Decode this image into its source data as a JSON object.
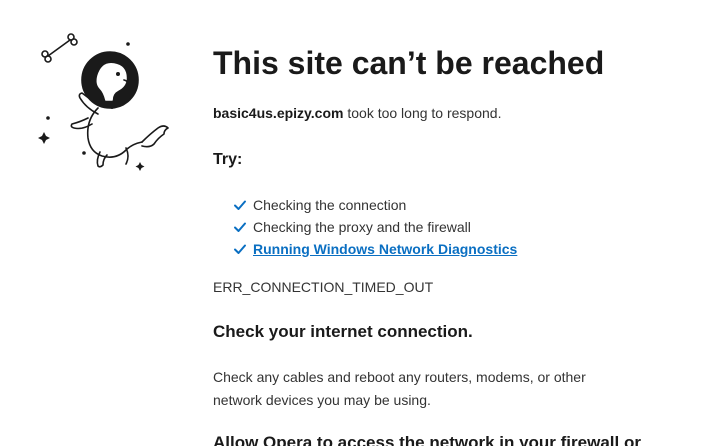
{
  "header": {
    "title": "This site can’t be reached"
  },
  "message": {
    "host": "basic4us.epizy.com",
    "suffix": " took too long to respond."
  },
  "try": {
    "heading": "Try:",
    "items": [
      {
        "label": "Checking the connection",
        "is_link": false
      },
      {
        "label": "Checking the proxy and the firewall",
        "is_link": false
      },
      {
        "label": "Running Windows Network Diagnostics",
        "is_link": true
      }
    ]
  },
  "error_code": "ERR_CONNECTION_TIMED_OUT",
  "sections": [
    {
      "title": "Check your internet connection.",
      "body": "Check any cables and reboot any routers, modems, or other network devices you may be using."
    },
    {
      "title": "Allow Opera to access the network in your firewall or"
    }
  ],
  "colors": {
    "accent": "#0a6fc2",
    "text": "#1a1a1a"
  },
  "icons": {
    "illustration": "astronaut-dog-icon",
    "check": "checkmark-icon"
  }
}
